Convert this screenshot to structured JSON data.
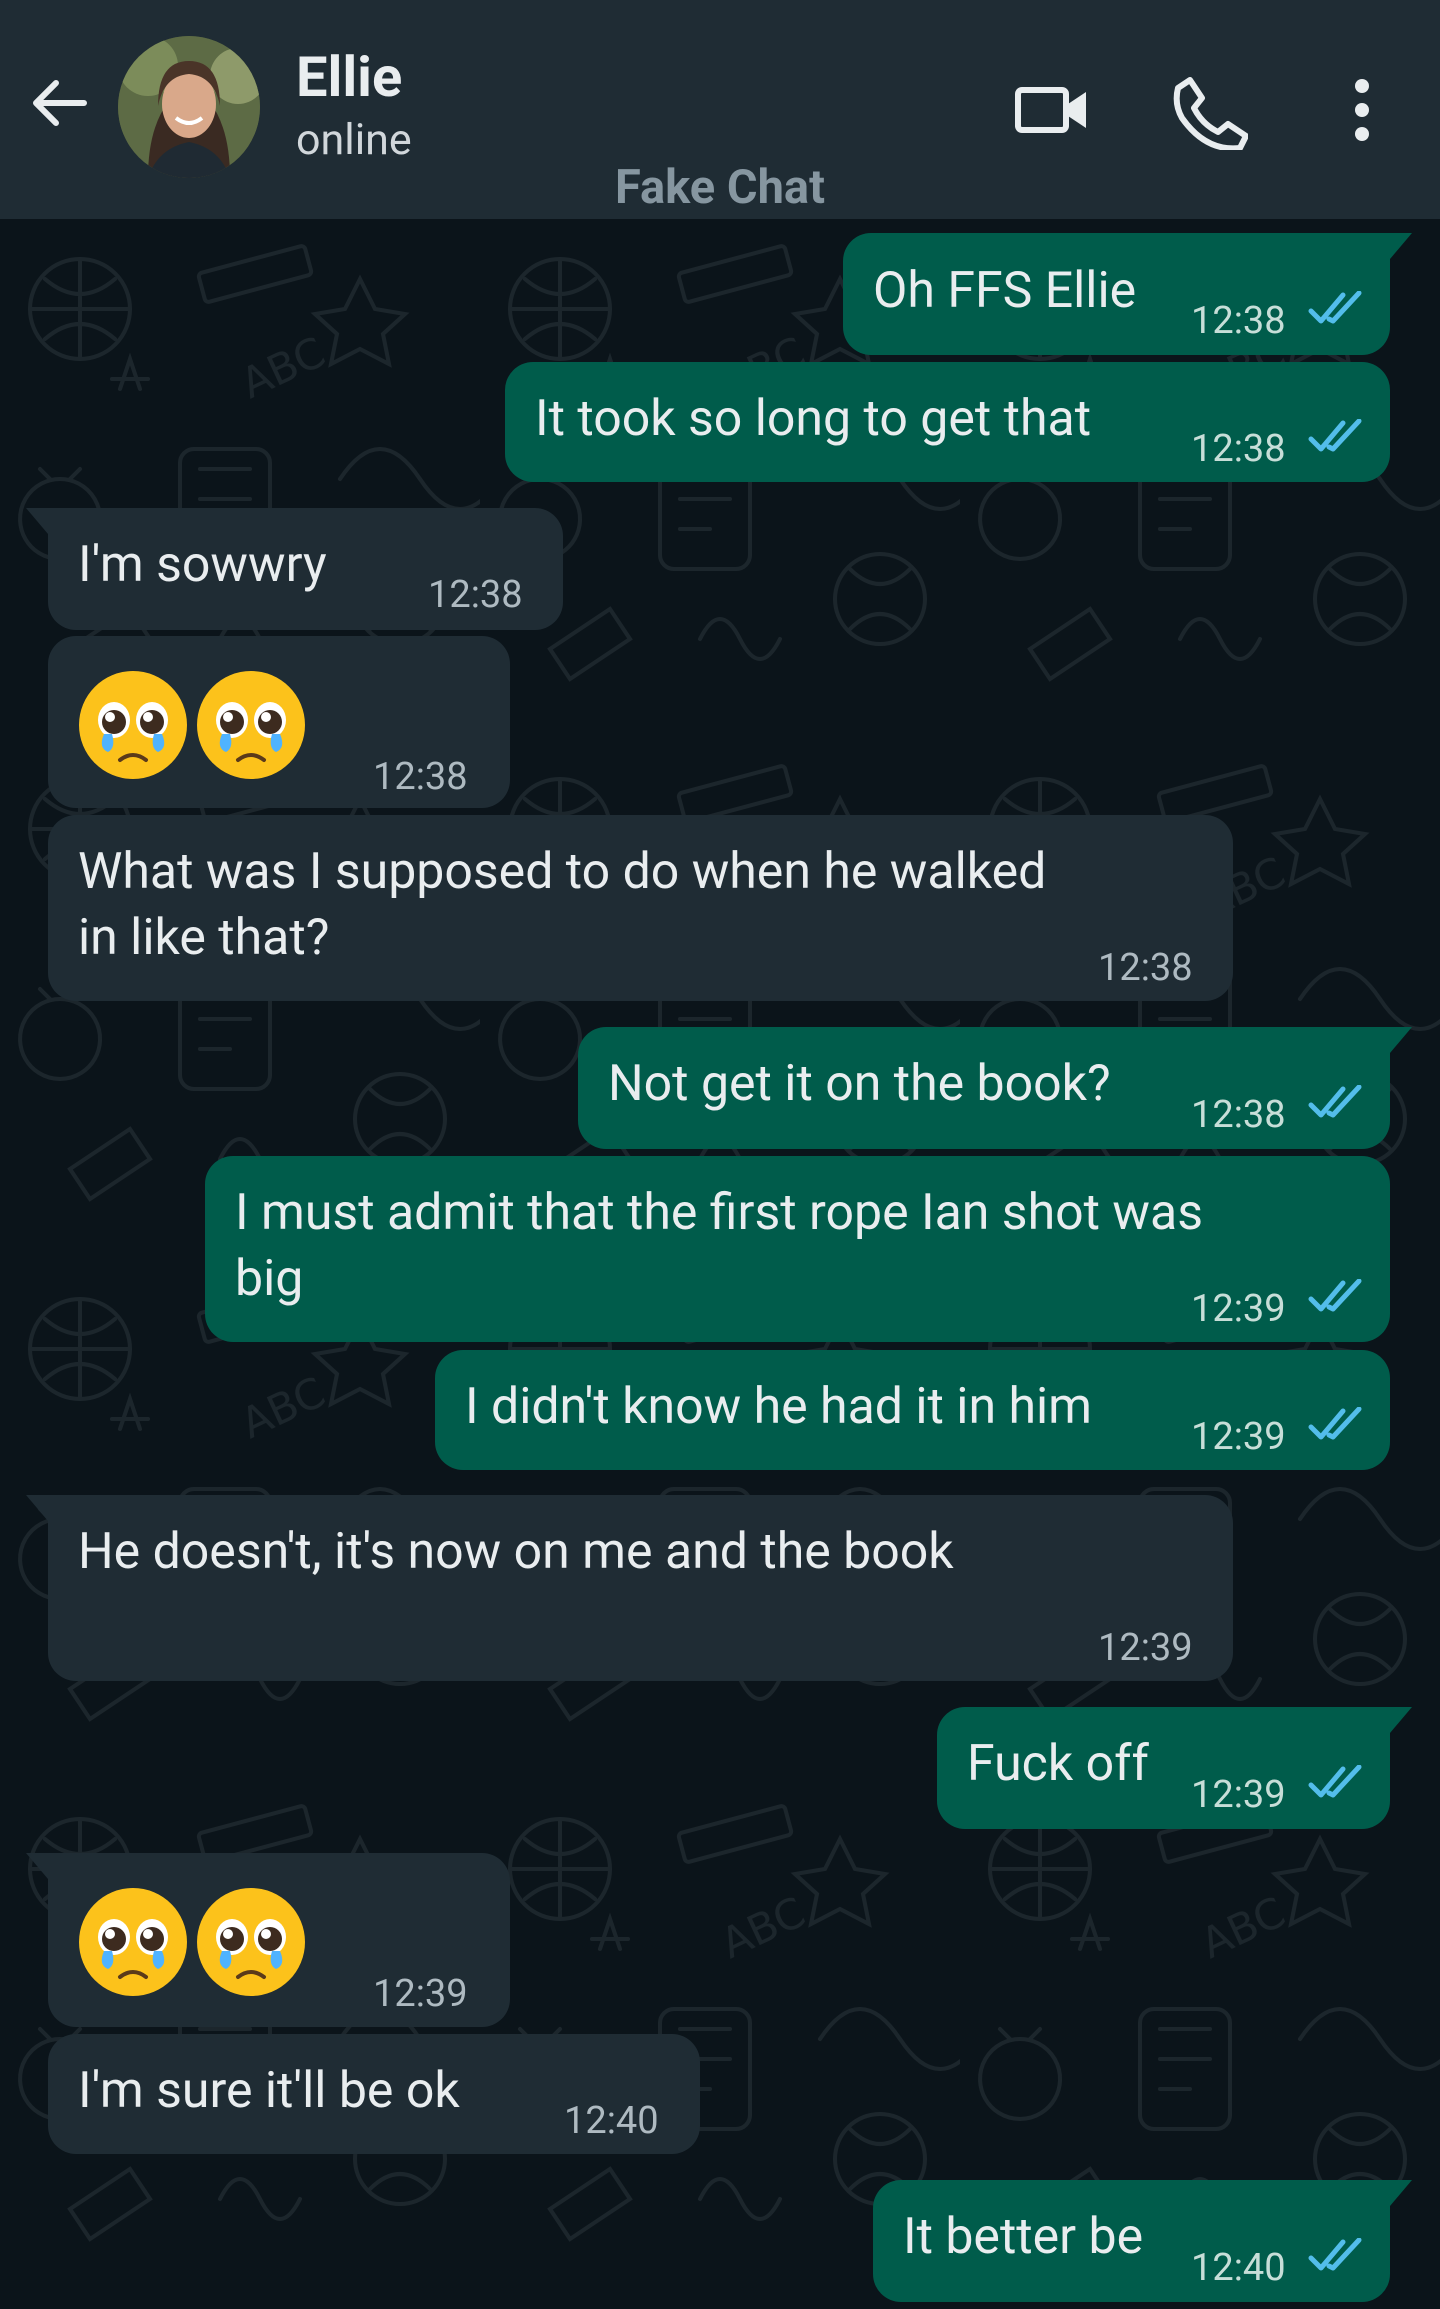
{
  "header": {
    "contact_name": "Ellie",
    "status": "online",
    "watermark": "Fake Chat"
  },
  "colors": {
    "header_bg": "#1f2c34",
    "chat_bg": "#0b141a",
    "incoming_bubble": "#1f2c34",
    "outgoing_bubble": "#005c4b",
    "read_tick": "#53bdeb"
  },
  "icons": [
    "back-arrow-icon",
    "video-call-icon",
    "phone-icon",
    "more-options-icon",
    "double-check-icon",
    "pleading-face-emoji"
  ],
  "messages": [
    {
      "dir": "out",
      "text": "Oh FFS Ellie",
      "time": "12:38",
      "read": true
    },
    {
      "dir": "out",
      "text": "It took so long to get that",
      "time": "12:38",
      "read": true
    },
    {
      "dir": "in",
      "text": "I'm sowwry",
      "time": "12:38"
    },
    {
      "dir": "in",
      "emoji": "🥹🥹",
      "time": "12:38"
    },
    {
      "dir": "in",
      "text_lines": [
        "What was I supposed to do when he walked",
        "in like that?"
      ],
      "time": "12:38"
    },
    {
      "dir": "out",
      "text": "Not get it on the book?",
      "time": "12:38",
      "read": true
    },
    {
      "dir": "out",
      "text_lines": [
        "I must admit that the first rope Ian shot was",
        "big"
      ],
      "time": "12:39",
      "read": true
    },
    {
      "dir": "out",
      "text": "I didn't know he had it in him",
      "time": "12:39",
      "read": true
    },
    {
      "dir": "in",
      "text": "He doesn't, it's now on me and the book",
      "time": "12:39"
    },
    {
      "dir": "out",
      "text": "Fuck off",
      "time": "12:39",
      "read": true
    },
    {
      "dir": "in",
      "emoji": "🥹🥹",
      "time": "12:39"
    },
    {
      "dir": "in",
      "text": "I'm sure it'll be ok",
      "time": "12:40"
    },
    {
      "dir": "out",
      "text": "It better be",
      "time": "12:40",
      "read": true
    }
  ]
}
